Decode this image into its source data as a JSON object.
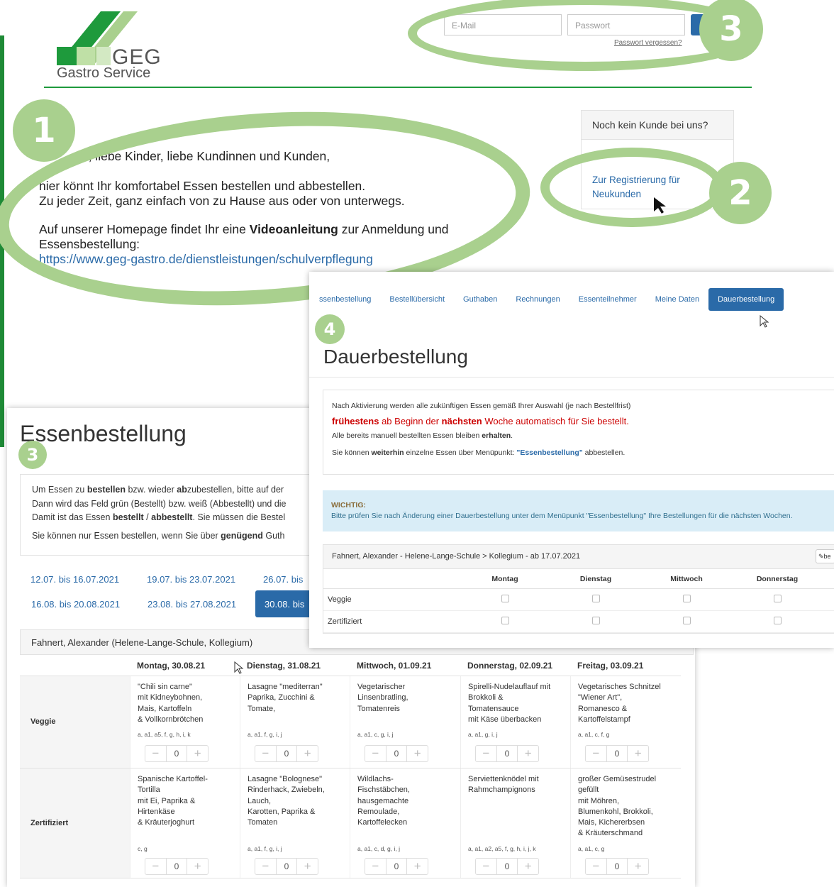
{
  "brand": {
    "name": "GEG",
    "subtitle": "Gastro Service",
    "colors": {
      "green": "#1e9a3c",
      "light_green": "#a9d08e",
      "blue": "#2a6aa8"
    }
  },
  "login": {
    "email_placeholder": "E-Mail",
    "password_placeholder": "Passwort",
    "forgot_link": "Passwort vergessen?"
  },
  "badges": {
    "b1": "1",
    "b2": "2",
    "b3": "3",
    "b3_small": "3",
    "b4": "4"
  },
  "welcome": {
    "greeting": "..., liebe Kinder, liebe Kundinnen und Kunden,",
    "line1": "hier könnt Ihr komfortabel Essen bestellen und abbestellen.",
    "line2": "Zu jeder Zeit, ganz einfach von zu Hause aus oder von unterwegs.",
    "line3_pre": "Auf unserer Homepage findet Ihr eine ",
    "line3_bold": "Videoanleitung",
    "line3_post": " zur Anmeldung und",
    "line4": "Essensbestellung:",
    "link": "https://www.geg-gastro.de/dienstleistungen/schulverpflegung"
  },
  "register": {
    "header": "Noch kein Kunde bei uns?",
    "link_line1": "Zur Registrierung für",
    "link_line2": "Neukunden"
  },
  "dauer": {
    "tabs": [
      "ssenbestellung",
      "Bestellübersicht",
      "Guthaben",
      "Rechnungen",
      "Essenteilnehmer",
      "Meine Daten",
      "Dauerbestellung"
    ],
    "title": "Dauerbestellung",
    "p1": "Nach Aktivierung werden alle zukünftigen Essen gemäß Ihrer Auswahl (je nach Bestellfrist)",
    "p2_bold1": "frühestens",
    "p2_mid": " ab Beginn der ",
    "p2_bold2": "nächsten",
    "p2_end": " Woche automatisch für Sie bestellt.",
    "p3_pre": "Alle bereits manuell bestellten Essen bleiben ",
    "p3_bold": "erhalten",
    ".": ".",
    "p4_pre": "Sie können ",
    "p4_bold": "weiterhin",
    "p4_mid": " einzelne Essen über Menüpunkt: ",
    "p4_quote": "\"Essenbestellung\"",
    "p4_end": " abbestellen.",
    "wichtig_title": "WICHTIG:",
    "wichtig_text": "Bitte prüfen Sie nach Änderung einer Dauerbestellung unter dem Menüpunkt \"Essenbestellung\" Ihre Bestellungen für die nächsten Wochen.",
    "participant": "Fahnert, Alexander - Helene-Lange-Schule > Kollegium - ab 17.07.2021",
    "edit_btn": "be",
    "days": [
      "Montag",
      "Dienstag",
      "Mittwoch",
      "Donnerstag"
    ],
    "rows": [
      "Veggie",
      "Zertifiziert"
    ]
  },
  "essen": {
    "title": "Essenbestellung",
    "i1_pre": "Um Essen zu ",
    "i1_b1": "bestellen",
    "i1_mid": " bzw. wieder ",
    "i1_b2": "ab",
    "i1_mid2": "zubestellen, bitte auf der",
    "i2": "Dann wird das Feld grün (Bestellt) bzw. weiß (Abbestellt) und die",
    "i3_pre": "Damit ist das Essen ",
    "i3_b1": "bestellt",
    " / ": " / ",
    "i3_b2": "abbestellt",
    "i3_end": ". Sie müssen die Bestel",
    "i4_pre": "Sie können nur Essen bestellen, wenn Sie über ",
    "i4_b": "genügend",
    "i4_end": " Guth",
    "weeks_row1": [
      "12.07. bis 16.07.2021",
      "19.07. bis 23.07.2021",
      "26.07. bis"
    ],
    "weeks_row2": [
      "16.08. bis 20.08.2021",
      "23.08. bis 27.08.2021",
      "30.08. bis"
    ],
    "participant": "Fahnert, Alexander (Helene-Lange-Schule, Kollegium)",
    "days": [
      "Montag, 30.08.21",
      "Dienstag, 31.08.21",
      "Mittwoch, 01.09.21",
      "Donnerstag, 02.09.21",
      "Freitag, 03.09.21"
    ],
    "rows": [
      {
        "label": "Veggie",
        "meals": [
          {
            "name": "\"Chili sin carne\"\nmit Kidneybohnen,\nMais, Kartoffeln\n& Vollkornbrötchen",
            "allergens": "a, a1, a5, f, g, h, i, k",
            "qty": "0"
          },
          {
            "name": "Lasagne \"mediterran\"\nPaprika, Zucchini &\nTomate,",
            "allergens": "a, a1, f, g, i, j",
            "qty": "0"
          },
          {
            "name": "Vegetarischer\nLinsenbratling,\nTomatenreis",
            "allergens": "a, a1, c, g, i, j",
            "qty": "0"
          },
          {
            "name": "Spirelli-Nudelauflauf mit\nBrokkoli &\nTomatensauce\nmit Käse überbacken",
            "allergens": "a, a1, g, i, j",
            "qty": "0"
          },
          {
            "name": "Vegetarisches Schnitzel\n\"Wiener Art\",\nRomanesco &\nKartoffelstampf",
            "allergens": "a, a1, c, f, g",
            "qty": "0"
          }
        ]
      },
      {
        "label": "Zertifiziert",
        "meals": [
          {
            "name": "Spanische Kartoffel-\nTortilla\nmit Ei, Paprika &\nHirtenkäse\n& Kräuterjoghurt",
            "allergens": "c, g",
            "qty": "0"
          },
          {
            "name": "Lasagne \"Bolognese\"\nRinderhack, Zwiebeln,\nLauch,\nKarotten, Paprika &\nTomaten",
            "allergens": "a, a1, f, g, i, j",
            "qty": "0"
          },
          {
            "name": "Wildlachs-\nFischstäbchen,\nhausgemachte\nRemoulade,\nKartoffelecken",
            "allergens": "a, a1, c, d, g, i, j",
            "qty": "0"
          },
          {
            "name": "Serviettenknödel mit\nRahmchampignons",
            "allergens": "a, a1, a2, a5, f, g, h, i, j, k",
            "qty": "0"
          },
          {
            "name": "großer Gemüsestrudel\ngefüllt\nmit Möhren,\nBlumenkohl, Brokkoli,\nMais, Kichererbsen\n& Kräuterschmand",
            "allergens": "a, a1, c, g",
            "qty": "0"
          }
        ]
      }
    ]
  }
}
